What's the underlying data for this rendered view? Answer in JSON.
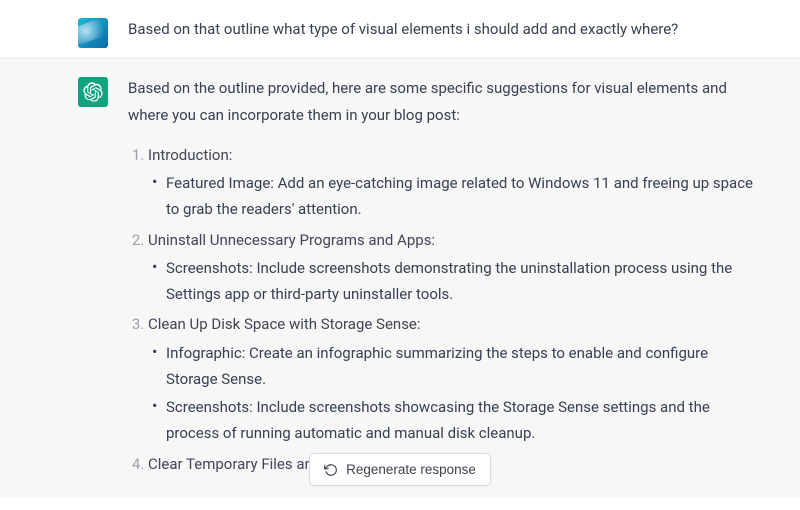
{
  "user_message": "Based on that outline what type of visual elements i should add and exactly where?",
  "assistant_intro": "Based on the outline provided, here are some specific suggestions for visual elements and where you can incorporate them in your blog post:",
  "list": [
    {
      "title": "Introduction:",
      "bullets": [
        "Featured Image: Add an eye-catching image related to Windows 11 and freeing up space to grab the readers' attention."
      ]
    },
    {
      "title": "Uninstall Unnecessary Programs and Apps:",
      "bullets": [
        "Screenshots: Include screenshots demonstrating the uninstallation process using the Settings app or third-party uninstaller tools."
      ]
    },
    {
      "title": "Clean Up Disk Space with Storage Sense:",
      "bullets": [
        "Infographic: Create an infographic summarizing the steps to enable and configure Storage Sense.",
        "Screenshots: Include screenshots showcasing the Storage Sense settings and the process of running automatic and manual disk cleanup."
      ]
    },
    {
      "title": "Clear Temporary Files and Cache:",
      "bullets": []
    }
  ],
  "regenerate_label": "Regenerate response"
}
